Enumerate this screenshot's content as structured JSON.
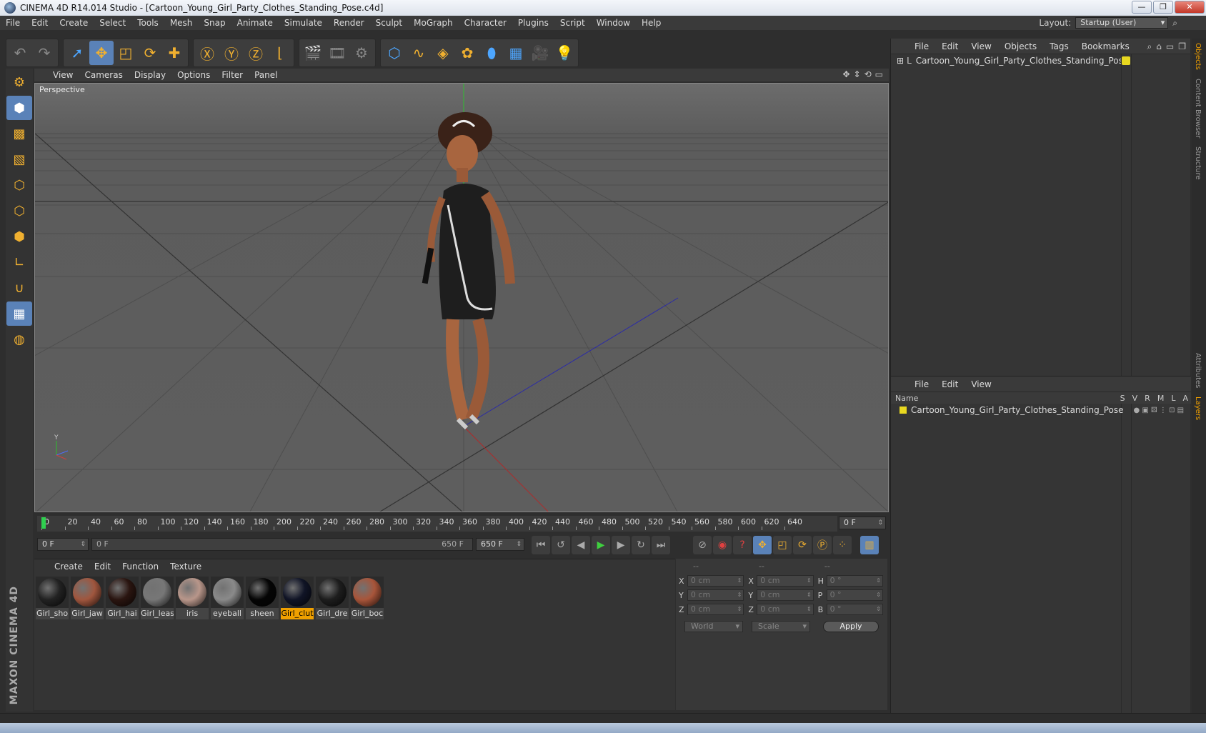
{
  "window": {
    "title": "CINEMA 4D R14.014 Studio - [Cartoon_Young_Girl_Party_Clothes_Standing_Pose.c4d]",
    "buttons": [
      "—",
      "❐",
      "✕"
    ]
  },
  "menubar": {
    "items": [
      "File",
      "Edit",
      "Create",
      "Select",
      "Tools",
      "Mesh",
      "Snap",
      "Animate",
      "Simulate",
      "Render",
      "Sculpt",
      "MoGraph",
      "Character",
      "Plugins",
      "Script",
      "Window",
      "Help"
    ],
    "layout_label": "Layout:",
    "layout_value": "Startup (User)"
  },
  "viewport": {
    "menu": [
      "View",
      "Cameras",
      "Display",
      "Options",
      "Filter",
      "Panel"
    ],
    "label": "Perspective"
  },
  "timeline": {
    "ticks": [
      "0",
      "20",
      "40",
      "60",
      "80",
      "100",
      "120",
      "140",
      "160",
      "180",
      "200",
      "220",
      "240",
      "260",
      "280",
      "300",
      "320",
      "340",
      "360",
      "380",
      "400",
      "420",
      "440",
      "460",
      "480",
      "500",
      "520",
      "540",
      "560",
      "580",
      "600",
      "620",
      "640"
    ],
    "current_frame": "0 F",
    "start_frame": "0 F",
    "range_start": "0 F",
    "range_end": "650 F",
    "end_frame": "650 F"
  },
  "materials": {
    "menu": [
      "Create",
      "Edit",
      "Function",
      "Texture"
    ],
    "items": [
      {
        "label": "Girl_sho",
        "color": "#222222"
      },
      {
        "label": "Girl_jaw",
        "color": "#a0563e"
      },
      {
        "label": "Girl_hai",
        "color": "#2a1510"
      },
      {
        "label": "Girl_leas",
        "color": "#777777"
      },
      {
        "label": "iris",
        "color": "#b8968a"
      },
      {
        "label": "eyeball",
        "color": "#8a8a8a"
      },
      {
        "label": "sheen",
        "color": "#050505"
      },
      {
        "label": "Girl_clut",
        "color": "#101426"
      },
      {
        "label": "Girl_dre",
        "color": "#1d1d1d"
      },
      {
        "label": "Girl_boc",
        "color": "#a8553a"
      }
    ]
  },
  "coordinates": {
    "headers": [
      "--",
      "--",
      "--"
    ],
    "rows": [
      {
        "a1": "X",
        "v1": "0 cm",
        "a2": "X",
        "v2": "0 cm",
        "a3": "H",
        "v3": "0 °"
      },
      {
        "a1": "Y",
        "v1": "0 cm",
        "a2": "Y",
        "v2": "0 cm",
        "a3": "P",
        "v3": "0 °"
      },
      {
        "a1": "Z",
        "v1": "0 cm",
        "a2": "Z",
        "v2": "0 cm",
        "a3": "B",
        "v3": "0 °"
      }
    ],
    "mode": "World",
    "transform": "Scale",
    "apply": "Apply"
  },
  "objects_panel": {
    "menu": [
      "File",
      "Edit",
      "View",
      "Objects",
      "Tags",
      "Bookmarks"
    ],
    "object_name": "Cartoon_Young_Girl_Party_Clothes_Standing_Pose"
  },
  "layers_panel": {
    "menu": [
      "File",
      "Edit",
      "View"
    ],
    "columns": [
      "Name",
      "S",
      "V",
      "R",
      "M",
      "L",
      "A"
    ],
    "layer_name": "Cartoon_Young_Girl_Party_Clothes_Standing_Pose"
  },
  "side_tabs": [
    "Objects",
    "Content Browser",
    "Structure",
    "Attributes",
    "Layers"
  ],
  "branding": "MAXON CINEMA 4D"
}
